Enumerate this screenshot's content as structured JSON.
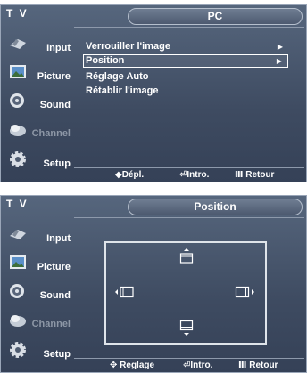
{
  "screen1": {
    "tv_label": "T V",
    "title": "PC",
    "sidebar": [
      {
        "label": "Input",
        "icon": "input-icon",
        "dim": false
      },
      {
        "label": "Picture",
        "icon": "picture-icon",
        "dim": false
      },
      {
        "label": "Sound",
        "icon": "sound-icon",
        "dim": false
      },
      {
        "label": "Channel",
        "icon": "channel-icon",
        "dim": true
      },
      {
        "label": "Setup",
        "icon": "setup-icon",
        "dim": false
      }
    ],
    "menu": [
      {
        "label": "Verrouiller l'image",
        "arrow": "▶"
      },
      {
        "label": "Position",
        "arrow": "▶"
      },
      {
        "label": "Réglage Auto",
        "arrow": ""
      },
      {
        "label": "Rétablir l'image",
        "arrow": ""
      }
    ],
    "footer": {
      "move": "◆Dépl.",
      "enter": "⏎Intro.",
      "back": "Ⅲ Retour"
    }
  },
  "screen2": {
    "tv_label": "T V",
    "title": "Position",
    "sidebar": [
      {
        "label": "Input",
        "icon": "input-icon",
        "dim": false
      },
      {
        "label": "Picture",
        "icon": "picture-icon",
        "dim": false
      },
      {
        "label": "Sound",
        "icon": "sound-icon",
        "dim": false
      },
      {
        "label": "Channel",
        "icon": "channel-icon",
        "dim": true
      },
      {
        "label": "Setup",
        "icon": "setup-icon",
        "dim": false
      }
    ],
    "footer": {
      "adjust": "✥ Reglage",
      "enter": "⏎Intro.",
      "back": "Ⅲ Retour"
    }
  },
  "colors": {
    "screen_bg": "#46546b",
    "text": "#ffffff",
    "dim_text": "#8d97a6"
  }
}
